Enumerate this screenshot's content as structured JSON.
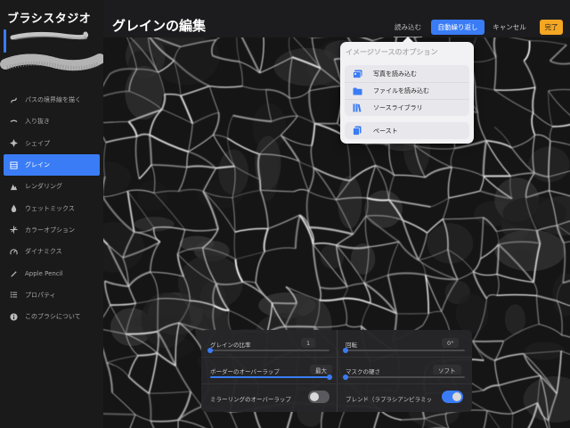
{
  "sidebar": {
    "title": "ブラシスタジオ",
    "items": [
      {
        "label": "パスの境界線を描く",
        "icon": "stroke-path-icon"
      },
      {
        "label": "入り抜き",
        "icon": "taper-icon"
      },
      {
        "label": "シェイプ",
        "icon": "shape-icon"
      },
      {
        "label": "グレイン",
        "icon": "grain-icon",
        "active": true
      },
      {
        "label": "レンダリング",
        "icon": "rendering-icon"
      },
      {
        "label": "ウェットミックス",
        "icon": "wet-mix-icon"
      },
      {
        "label": "カラーオプション",
        "icon": "color-dynamics-icon"
      },
      {
        "label": "ダイナミクス",
        "icon": "dynamics-icon"
      },
      {
        "label": "Apple Pencil",
        "icon": "pencil-icon"
      },
      {
        "label": "プロパティ",
        "icon": "properties-icon"
      },
      {
        "label": "このブラシについて",
        "icon": "info-icon"
      }
    ]
  },
  "header": {
    "title": "グレインの編集",
    "import_label": "読み込む",
    "autorepeat_label": "自動繰り返し",
    "cancel_label": "キャンセル",
    "done_label": "完了"
  },
  "popover": {
    "title": "イメージソースのオプション",
    "items": [
      {
        "label": "写真を読み込む",
        "icon": "photo-icon"
      },
      {
        "label": "ファイルを読み込む",
        "icon": "folder-icon"
      },
      {
        "label": "ソースライブラリ",
        "icon": "library-icon"
      }
    ],
    "paste_label": "ペースト",
    "paste_icon": "paste-icon"
  },
  "settings": {
    "grain_scale": {
      "label": "グレインの比率",
      "value": "1",
      "level": 0.0
    },
    "rotation": {
      "label": "回転",
      "value": "0°",
      "level": 0.0
    },
    "border_overlap": {
      "label": "ボーダーのオーバーラップ",
      "value": "最大",
      "level": 1.0
    },
    "mask_hardness": {
      "label": "マスクの硬さ",
      "value": "ソフト",
      "level": 0.0
    },
    "mirror_overlap": {
      "label": "ミラーリングのオーバーラップ",
      "on": false
    },
    "blend": {
      "label": "ブレンド（ラプラシアンピラミッ",
      "on": true
    }
  },
  "colors": {
    "accent": "#3a7cf5",
    "done": "#f5a623",
    "sidebar_bg": "#1a1a1a",
    "popover_bg": "#f2f2f4"
  }
}
